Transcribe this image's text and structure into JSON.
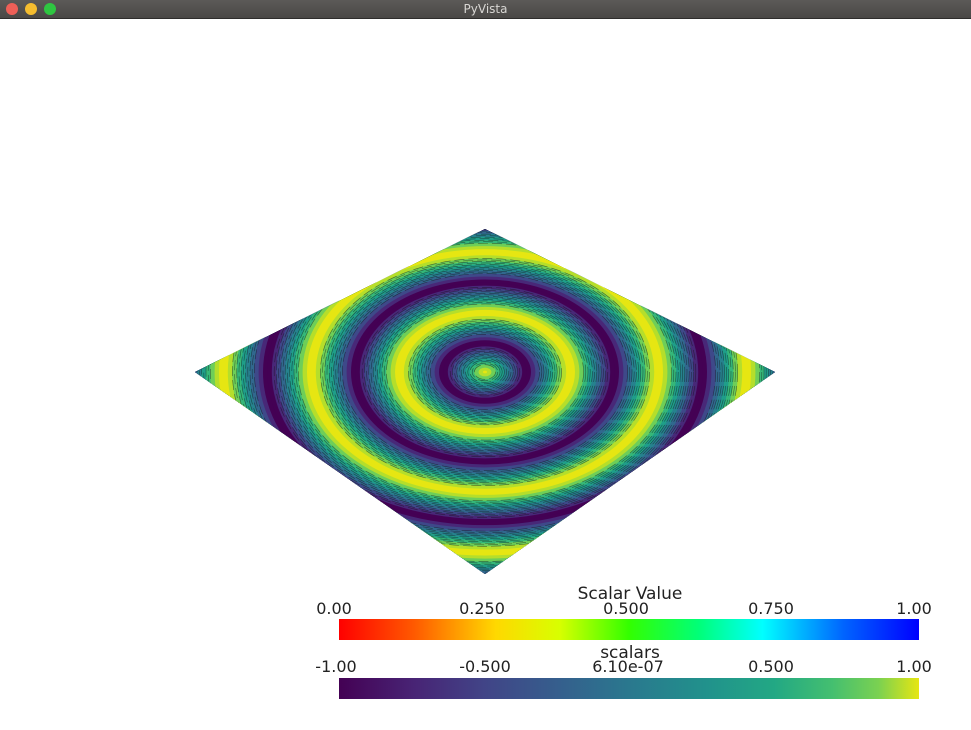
{
  "window": {
    "title": "PyVista"
  },
  "plot": {
    "surface_colormap": "viridis",
    "pattern": "concentric rings on a tilted square plane"
  },
  "scalar_bars": [
    {
      "title": "Scalar Value",
      "colormap": "jet-like",
      "ticks": [
        "0.00",
        "0.250",
        "0.500",
        "0.750",
        "1.00"
      ]
    },
    {
      "title": "scalars",
      "colormap": "viridis",
      "ticks": [
        "-1.00",
        "-0.500",
        "6.10e-07",
        "0.500",
        "1.00"
      ]
    }
  ]
}
